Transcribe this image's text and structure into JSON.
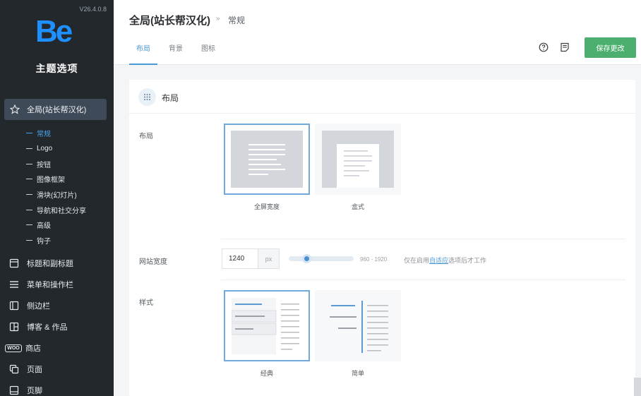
{
  "sidebar": {
    "version": "V26.4.0.8",
    "logo_text": "Be",
    "theme_title": "主题选项",
    "active_item": {
      "label": "全局(站长帮汉化)",
      "icon": "star-icon"
    },
    "subitems": [
      {
        "label": "常规",
        "active": true
      },
      {
        "label": "Logo"
      },
      {
        "label": "按钮"
      },
      {
        "label": "图像框架"
      },
      {
        "label": "滑块(幻灯片)"
      },
      {
        "label": "导航和社交分享"
      },
      {
        "label": "高级"
      },
      {
        "label": "钩子"
      }
    ],
    "items": [
      {
        "label": "标题和副标题",
        "icon": "header-icon"
      },
      {
        "label": "菜单和操作栏",
        "icon": "menu-icon"
      },
      {
        "label": "侧边栏",
        "icon": "sidebar-icon"
      },
      {
        "label": "博客 & 作品",
        "icon": "grid-icon"
      },
      {
        "label": "商店",
        "icon": "woo-icon",
        "icon_text": "WOO"
      },
      {
        "label": "页面",
        "icon": "pages-icon"
      },
      {
        "label": "页脚",
        "icon": "footer-icon"
      }
    ]
  },
  "header": {
    "title": "全局(站长帮汉化)",
    "separator": "»",
    "current": "常规",
    "tabs": [
      {
        "label": "布局",
        "active": true
      },
      {
        "label": "背景"
      },
      {
        "label": "图标"
      }
    ],
    "help_icon": "help-icon",
    "notes_icon": "notes-icon",
    "save_label": "保存更改"
  },
  "panel": {
    "title": "布局",
    "layout": {
      "label": "布局",
      "options": [
        {
          "label": "全屏宽度",
          "selected": true
        },
        {
          "label": "盒式",
          "selected": false
        }
      ]
    },
    "site_width": {
      "label": "网站宽度",
      "value": "1240",
      "unit": "px",
      "range": "960 - 1920",
      "min": 960,
      "max": 1920,
      "hint_prefix": "仅在启用",
      "hint_link": "自适应",
      "hint_suffix": "选项后才工作"
    },
    "style": {
      "label": "样式",
      "options": [
        {
          "label": "经典",
          "selected": true
        },
        {
          "label": "简单",
          "selected": false
        }
      ]
    }
  },
  "colors": {
    "sidebar_bg": "#23282d",
    "accent": "#4b9ad8",
    "save": "#4caf6f",
    "logo": "#1e90ff"
  }
}
